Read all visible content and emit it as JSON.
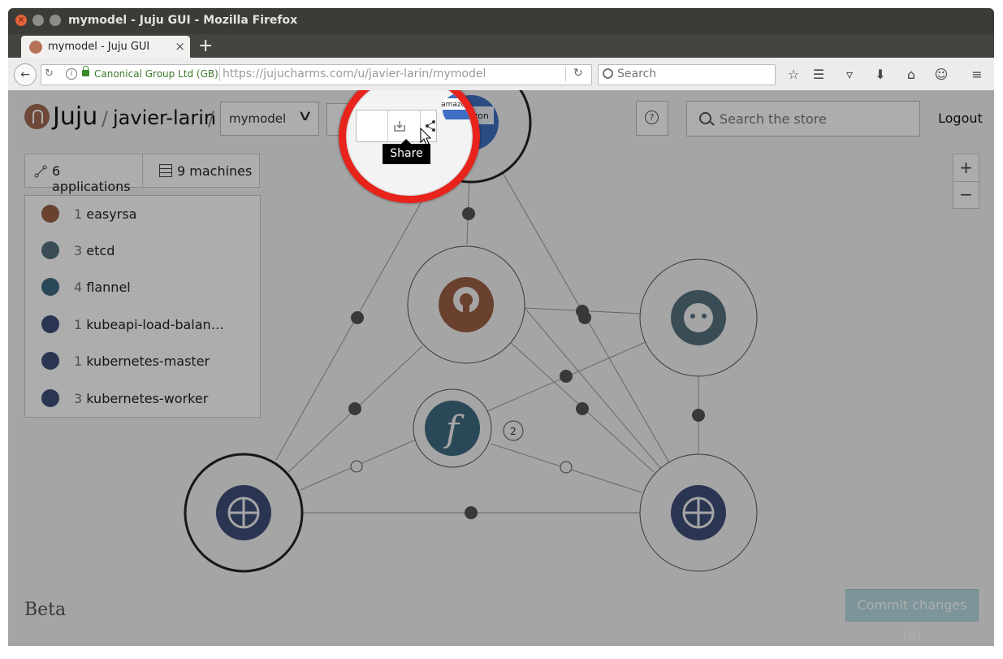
{
  "window": {
    "title": "mymodel - Juju GUI - Mozilla Firefox"
  },
  "browser": {
    "tab_title": "mymodel - Juju GUI",
    "tab_close": "×",
    "new_tab": "+",
    "org": "Canonical Group Ltd (GB)",
    "url": "https://jujucharms.com/u/javier-larin/mymodel",
    "search_placeholder": "Search"
  },
  "header": {
    "brand": "Juju",
    "slash": "/",
    "user": "javier-larin",
    "model": "mymodel",
    "help": "?",
    "store_search_placeholder": "Search the store",
    "logout": "Logout"
  },
  "summary": {
    "applications": "6 applications",
    "machines": "9 machines"
  },
  "applications": [
    {
      "count": "1",
      "name": "easyrsa",
      "color": "#9c5f44"
    },
    {
      "count": "3",
      "name": "etcd",
      "color": "#56707f"
    },
    {
      "count": "4",
      "name": "flannel",
      "color": "#3f6a80"
    },
    {
      "count": "1",
      "name": "kubeapi-load-balan…",
      "color": "#3e4f7a"
    },
    {
      "count": "1",
      "name": "kubernetes-master",
      "color": "#3e4f7a"
    },
    {
      "count": "3",
      "name": "kubernetes-worker",
      "color": "#3e4f7a"
    }
  ],
  "zoom": {
    "in": "+",
    "out": "−"
  },
  "canvas": {
    "relation_badge": "2",
    "aws_label": "amazon web services"
  },
  "tooltip": {
    "share": "Share"
  },
  "footer": {
    "beta": "Beta",
    "commit": "Commit changes (0)"
  },
  "colors": {
    "magnifier_ring": "#e8231b",
    "commit_bg": "#b8dbe5"
  }
}
